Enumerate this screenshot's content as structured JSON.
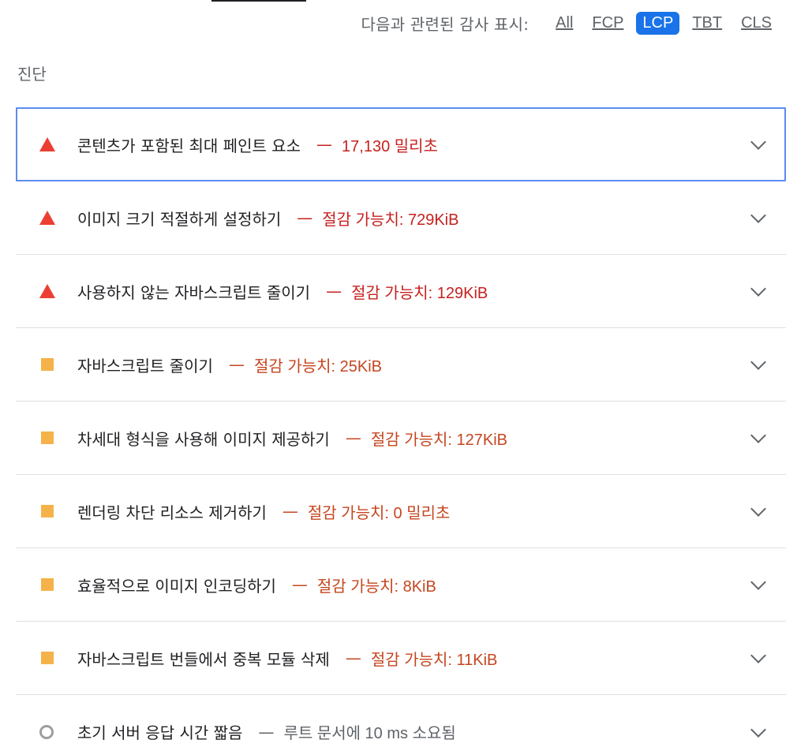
{
  "filter": {
    "label": "다음과 관련된 감사 표시:",
    "options": [
      "All",
      "FCP",
      "LCP",
      "TBT",
      "CLS"
    ],
    "active": "LCP"
  },
  "section": {
    "title": "진단"
  },
  "audits": [
    {
      "title": "콘텐츠가 포함된 최대 페인트 요소",
      "separator": "—",
      "value": "17,130 밀리초",
      "severity": "fail"
    },
    {
      "title": "이미지 크기 적절하게 설정하기",
      "separator": "—",
      "value": "절감 가능치: 729KiB",
      "severity": "fail"
    },
    {
      "title": "사용하지 않는 자바스크립트 줄이기",
      "separator": "—",
      "value": "절감 가능치: 129KiB",
      "severity": "fail"
    },
    {
      "title": "자바스크립트 줄이기",
      "separator": "—",
      "value": "절감 가능치: 25KiB",
      "severity": "average"
    },
    {
      "title": "차세대 형식을 사용해 이미지 제공하기",
      "separator": "—",
      "value": "절감 가능치: 127KiB",
      "severity": "average"
    },
    {
      "title": "렌더링 차단 리소스 제거하기",
      "separator": "—",
      "value": "절감 가능치: 0 밀리초",
      "severity": "average"
    },
    {
      "title": "효율적으로 이미지 인코딩하기",
      "separator": "—",
      "value": "절감 가능치: 8KiB",
      "severity": "average"
    },
    {
      "title": "자바스크립트 번들에서 중복 모듈 삭제",
      "separator": "—",
      "value": "절감 가능치: 11KiB",
      "severity": "average"
    },
    {
      "title": "초기 서버 응답 시간 짧음",
      "separator": "—",
      "value": "루트 문서에 10 ms 소요됨",
      "severity": "informative"
    }
  ],
  "colors": {
    "fail": "#eb3f34",
    "average": "#f6b24a",
    "informative": "#9e9e9e",
    "accent": "#1a73e8"
  }
}
